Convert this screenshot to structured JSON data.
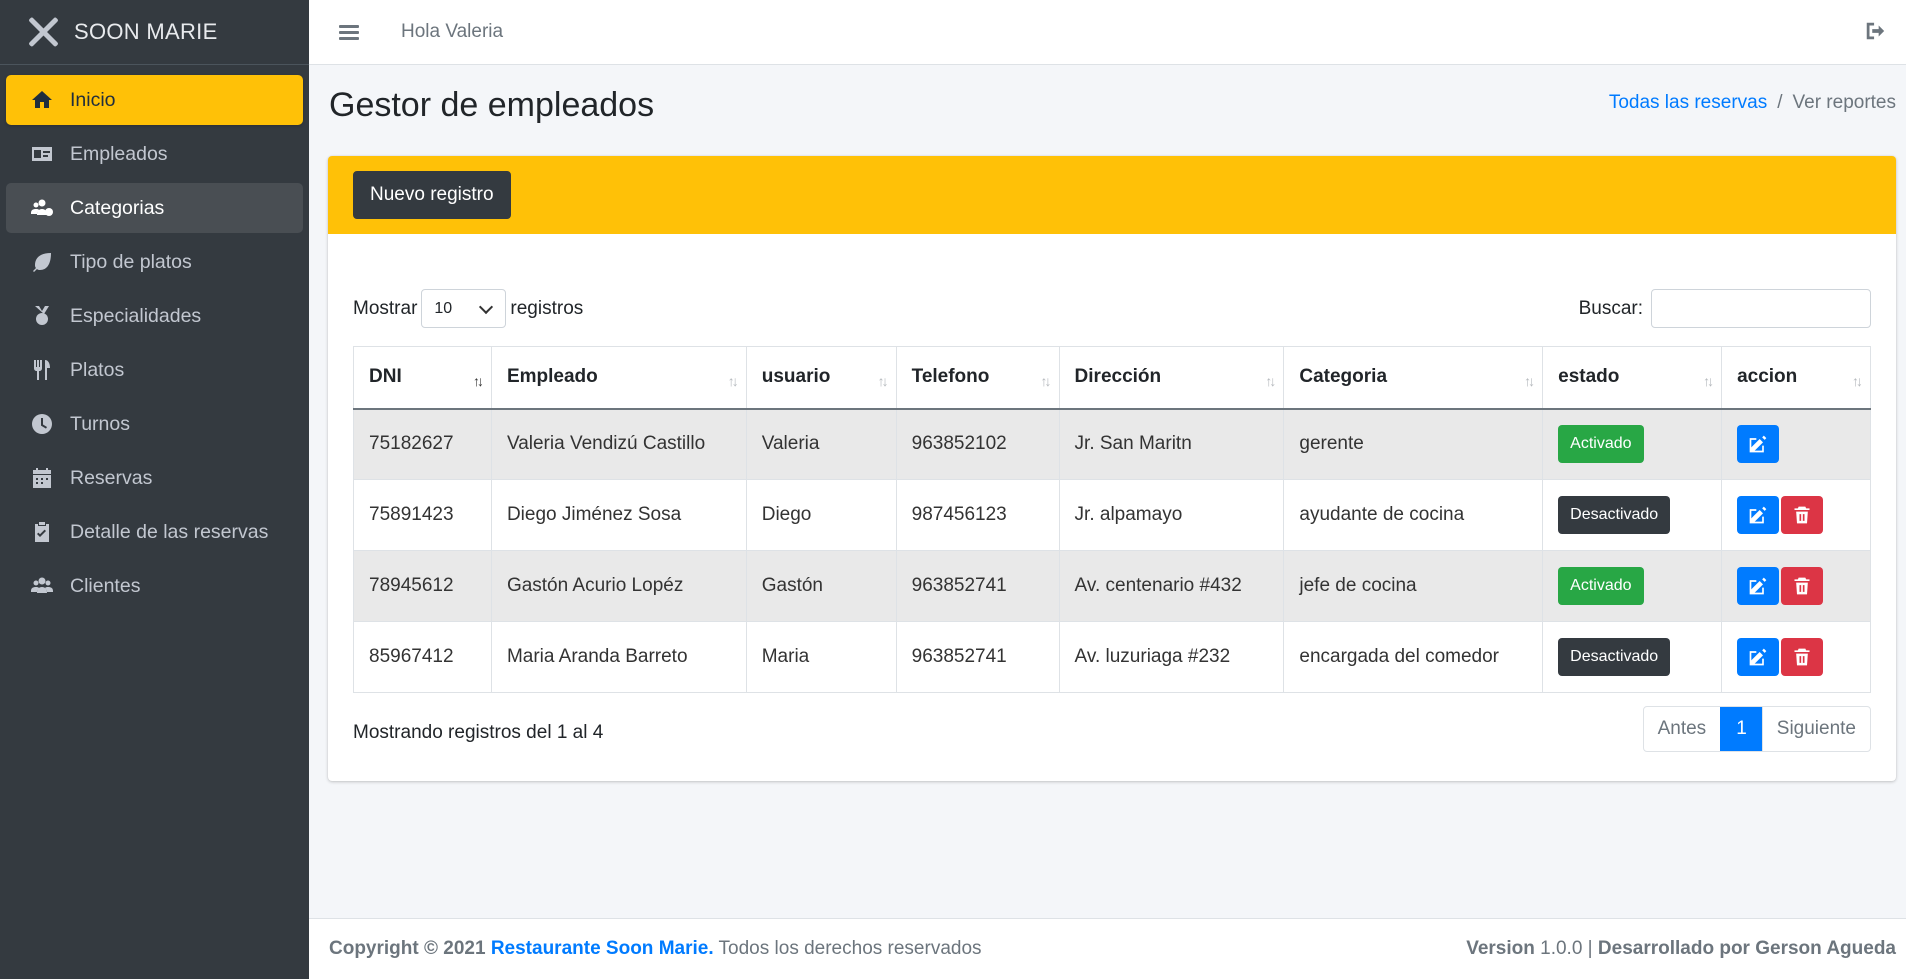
{
  "brand": {
    "name": "SOON MARIE"
  },
  "sidebar": {
    "items": [
      {
        "label": "Inicio",
        "icon": "home-icon"
      },
      {
        "label": "Empleados",
        "icon": "id-card-icon"
      },
      {
        "label": "Categorias",
        "icon": "users-cog-icon"
      },
      {
        "label": "Tipo de platos",
        "icon": "leaf-icon"
      },
      {
        "label": "Especialidades",
        "icon": "medal-icon"
      },
      {
        "label": "Platos",
        "icon": "utensils-icon"
      },
      {
        "label": "Turnos",
        "icon": "clock-icon"
      },
      {
        "label": "Reservas",
        "icon": "calendar-icon"
      },
      {
        "label": "Detalle de las reservas",
        "icon": "clipboard-check-icon"
      },
      {
        "label": "Clientes",
        "icon": "users-icon"
      }
    ]
  },
  "topbar": {
    "greeting": "Hola Valeria"
  },
  "page": {
    "title": "Gestor de empleados",
    "breadcrumb": {
      "link": "Todas las reservas",
      "current": "Ver reportes"
    }
  },
  "card": {
    "new_button": "Nuevo registro",
    "show_label": "Mostrar",
    "show_value": "10",
    "records_label": "registros",
    "search_label": "Buscar:"
  },
  "table": {
    "headers": [
      "DNI",
      "Empleado",
      "usuario",
      "Telefono",
      "Dirección",
      "Categoria",
      "estado",
      "accion"
    ],
    "rows": [
      {
        "dni": "75182627",
        "empleado": "Valeria Vendizú Castillo",
        "usuario": "Valeria",
        "telefono": "963852102",
        "direccion": "Jr. San Maritn",
        "categoria": "gerente",
        "estado": "Activado"
      },
      {
        "dni": "75891423",
        "empleado": "Diego Jiménez Sosa",
        "usuario": "Diego",
        "telefono": "987456123",
        "direccion": "Jr. alpamayo",
        "categoria": "ayudante de cocina",
        "estado": "Desactivado"
      },
      {
        "dni": "78945612",
        "empleado": "Gastón Acurio Lopéz",
        "usuario": "Gastón",
        "telefono": "963852741",
        "direccion": "Av. centenario #432",
        "categoria": "jefe de cocina",
        "estado": "Activado"
      },
      {
        "dni": "85967412",
        "empleado": "Maria Aranda Barreto",
        "usuario": "Maria",
        "telefono": "963852741",
        "direccion": "Av. luzuriaga #232",
        "categoria": "encargada del comedor",
        "estado": "Desactivado"
      }
    ]
  },
  "pagination": {
    "info": "Mostrando registros del 1 al 4",
    "prev": "Antes",
    "current": "1",
    "next": "Siguiente"
  },
  "footer": {
    "copyright": "Copyright © 2021",
    "company": "Restaurante Soon Marie.",
    "rights": "Todos los derechos reservados",
    "version_label": "Version",
    "version": "1.0.0",
    "developer": "Desarrollado por Gerson Agueda"
  },
  "colors": {
    "accent": "#ffc107",
    "sidebar": "#343a40",
    "primary": "#007bff",
    "success": "#28a745",
    "danger": "#dc3545"
  }
}
